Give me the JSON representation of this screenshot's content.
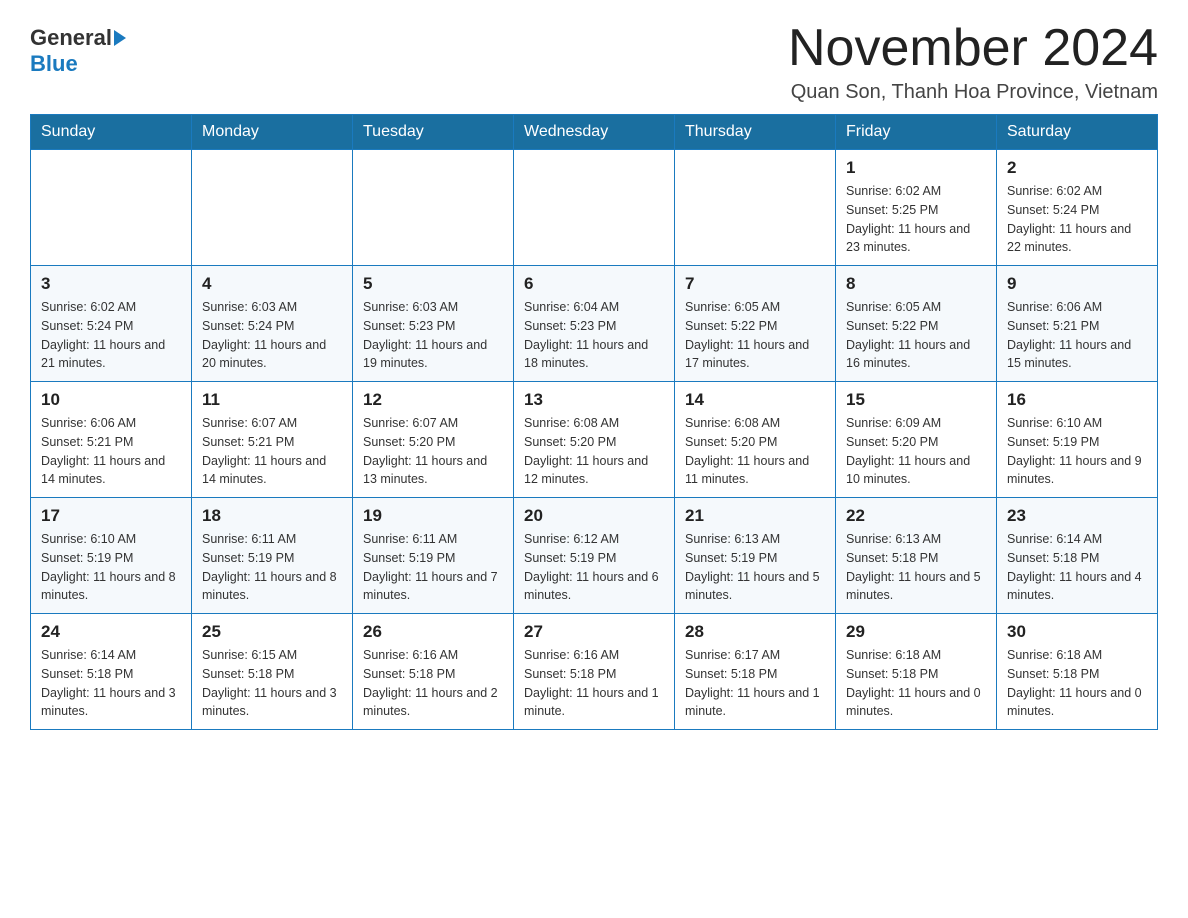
{
  "logo": {
    "general": "General",
    "blue": "Blue"
  },
  "title": "November 2024",
  "subtitle": "Quan Son, Thanh Hoa Province, Vietnam",
  "days_of_week": [
    "Sunday",
    "Monday",
    "Tuesday",
    "Wednesday",
    "Thursday",
    "Friday",
    "Saturday"
  ],
  "weeks": [
    [
      {
        "day": "",
        "info": ""
      },
      {
        "day": "",
        "info": ""
      },
      {
        "day": "",
        "info": ""
      },
      {
        "day": "",
        "info": ""
      },
      {
        "day": "",
        "info": ""
      },
      {
        "day": "1",
        "info": "Sunrise: 6:02 AM\nSunset: 5:25 PM\nDaylight: 11 hours and 23 minutes."
      },
      {
        "day": "2",
        "info": "Sunrise: 6:02 AM\nSunset: 5:24 PM\nDaylight: 11 hours and 22 minutes."
      }
    ],
    [
      {
        "day": "3",
        "info": "Sunrise: 6:02 AM\nSunset: 5:24 PM\nDaylight: 11 hours and 21 minutes."
      },
      {
        "day": "4",
        "info": "Sunrise: 6:03 AM\nSunset: 5:24 PM\nDaylight: 11 hours and 20 minutes."
      },
      {
        "day": "5",
        "info": "Sunrise: 6:03 AM\nSunset: 5:23 PM\nDaylight: 11 hours and 19 minutes."
      },
      {
        "day": "6",
        "info": "Sunrise: 6:04 AM\nSunset: 5:23 PM\nDaylight: 11 hours and 18 minutes."
      },
      {
        "day": "7",
        "info": "Sunrise: 6:05 AM\nSunset: 5:22 PM\nDaylight: 11 hours and 17 minutes."
      },
      {
        "day": "8",
        "info": "Sunrise: 6:05 AM\nSunset: 5:22 PM\nDaylight: 11 hours and 16 minutes."
      },
      {
        "day": "9",
        "info": "Sunrise: 6:06 AM\nSunset: 5:21 PM\nDaylight: 11 hours and 15 minutes."
      }
    ],
    [
      {
        "day": "10",
        "info": "Sunrise: 6:06 AM\nSunset: 5:21 PM\nDaylight: 11 hours and 14 minutes."
      },
      {
        "day": "11",
        "info": "Sunrise: 6:07 AM\nSunset: 5:21 PM\nDaylight: 11 hours and 14 minutes."
      },
      {
        "day": "12",
        "info": "Sunrise: 6:07 AM\nSunset: 5:20 PM\nDaylight: 11 hours and 13 minutes."
      },
      {
        "day": "13",
        "info": "Sunrise: 6:08 AM\nSunset: 5:20 PM\nDaylight: 11 hours and 12 minutes."
      },
      {
        "day": "14",
        "info": "Sunrise: 6:08 AM\nSunset: 5:20 PM\nDaylight: 11 hours and 11 minutes."
      },
      {
        "day": "15",
        "info": "Sunrise: 6:09 AM\nSunset: 5:20 PM\nDaylight: 11 hours and 10 minutes."
      },
      {
        "day": "16",
        "info": "Sunrise: 6:10 AM\nSunset: 5:19 PM\nDaylight: 11 hours and 9 minutes."
      }
    ],
    [
      {
        "day": "17",
        "info": "Sunrise: 6:10 AM\nSunset: 5:19 PM\nDaylight: 11 hours and 8 minutes."
      },
      {
        "day": "18",
        "info": "Sunrise: 6:11 AM\nSunset: 5:19 PM\nDaylight: 11 hours and 8 minutes."
      },
      {
        "day": "19",
        "info": "Sunrise: 6:11 AM\nSunset: 5:19 PM\nDaylight: 11 hours and 7 minutes."
      },
      {
        "day": "20",
        "info": "Sunrise: 6:12 AM\nSunset: 5:19 PM\nDaylight: 11 hours and 6 minutes."
      },
      {
        "day": "21",
        "info": "Sunrise: 6:13 AM\nSunset: 5:19 PM\nDaylight: 11 hours and 5 minutes."
      },
      {
        "day": "22",
        "info": "Sunrise: 6:13 AM\nSunset: 5:18 PM\nDaylight: 11 hours and 5 minutes."
      },
      {
        "day": "23",
        "info": "Sunrise: 6:14 AM\nSunset: 5:18 PM\nDaylight: 11 hours and 4 minutes."
      }
    ],
    [
      {
        "day": "24",
        "info": "Sunrise: 6:14 AM\nSunset: 5:18 PM\nDaylight: 11 hours and 3 minutes."
      },
      {
        "day": "25",
        "info": "Sunrise: 6:15 AM\nSunset: 5:18 PM\nDaylight: 11 hours and 3 minutes."
      },
      {
        "day": "26",
        "info": "Sunrise: 6:16 AM\nSunset: 5:18 PM\nDaylight: 11 hours and 2 minutes."
      },
      {
        "day": "27",
        "info": "Sunrise: 6:16 AM\nSunset: 5:18 PM\nDaylight: 11 hours and 1 minute."
      },
      {
        "day": "28",
        "info": "Sunrise: 6:17 AM\nSunset: 5:18 PM\nDaylight: 11 hours and 1 minute."
      },
      {
        "day": "29",
        "info": "Sunrise: 6:18 AM\nSunset: 5:18 PM\nDaylight: 11 hours and 0 minutes."
      },
      {
        "day": "30",
        "info": "Sunrise: 6:18 AM\nSunset: 5:18 PM\nDaylight: 11 hours and 0 minutes."
      }
    ]
  ]
}
